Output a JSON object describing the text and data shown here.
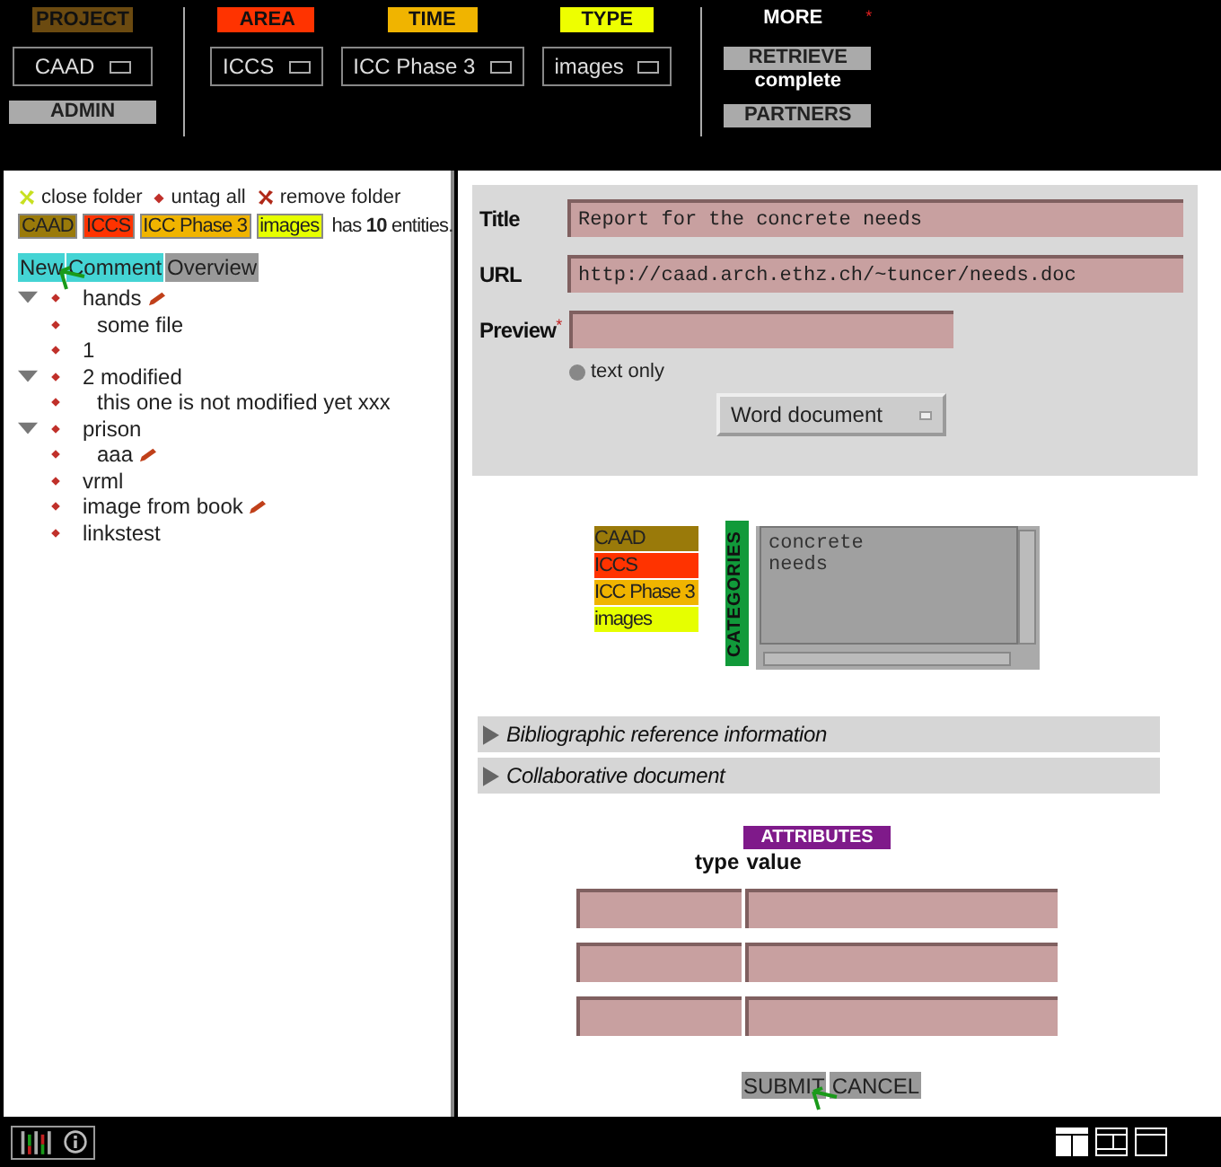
{
  "header": {
    "project": {
      "label": "PROJECT",
      "color": "#6b4a10",
      "value": "CAAD",
      "admin": "ADMIN"
    },
    "filters": [
      {
        "label": "AREA",
        "color": "#ff3300",
        "value": "ICCS"
      },
      {
        "label": "TIME",
        "color": "#f0b400",
        "value": "ICC Phase 3"
      },
      {
        "label": "TYPE",
        "color": "#eeff00",
        "value": "images"
      }
    ],
    "more": {
      "label": "MORE",
      "mark": "*",
      "retrieve": "RETRIEVE",
      "status": "complete",
      "partners": "PARTNERS"
    }
  },
  "folder_actions": [
    {
      "kind": "close",
      "label": "close folder"
    },
    {
      "kind": "untag",
      "label": "untag all"
    },
    {
      "kind": "remove",
      "label": "remove folder"
    }
  ],
  "tags": [
    {
      "label": "CAAD",
      "color": "#9a7a0a"
    },
    {
      "label": "ICCS",
      "color": "#ff3300"
    },
    {
      "label": "ICC Phase 3",
      "color": "#f0b400"
    },
    {
      "label": "images",
      "color": "#e6ff00"
    }
  ],
  "entity_count": "has **10** entities.",
  "tabs": [
    {
      "label": "New",
      "selected": true
    },
    {
      "label": "Comment",
      "selected": true
    },
    {
      "label": "Overview",
      "selected": false
    }
  ],
  "tree": [
    {
      "label": "hands",
      "editable": true,
      "expanded": true,
      "children": [
        {
          "label": "some file"
        }
      ]
    },
    {
      "label": "1"
    },
    {
      "label": "2 modified",
      "expanded": true,
      "children": [
        {
          "label": "this one is not modified yet xxx"
        }
      ]
    },
    {
      "label": "prison",
      "expanded": true,
      "children": [
        {
          "label": "aaa",
          "editable": true
        }
      ]
    },
    {
      "label": "vrml"
    },
    {
      "label": "image from book",
      "editable": true
    },
    {
      "label": "linkstest"
    }
  ],
  "form": {
    "fields": [
      {
        "label": "Title",
        "value": "Report for the concrete needs",
        "kind": "wide"
      },
      {
        "label": "URL",
        "value": "http://caad.arch.ethz.ch/~tuncer/needs.doc",
        "kind": "wide"
      },
      {
        "label": "Preview",
        "mark": "*",
        "kind": "short"
      }
    ],
    "radio": {
      "label": "text only",
      "checked": false
    },
    "doc_type": "Word document"
  },
  "categories": {
    "label": "CATEGORIES",
    "tags": [
      {
        "label": "CAAD",
        "color": "#9a7a0a"
      },
      {
        "label": "ICCS",
        "color": "#ff3300"
      },
      {
        "label": "ICC Phase 3",
        "color": "#f0b400"
      },
      {
        "label": "images",
        "color": "#e6ff00"
      }
    ],
    "text": "concrete\nneeds"
  },
  "sections": [
    {
      "label": "Bibliographic reference information",
      "expanded": false
    },
    {
      "label": "Collaborative document",
      "expanded": false
    }
  ],
  "attributes": {
    "title": "ATTRIBUTES",
    "columns": [
      "type",
      "value"
    ],
    "rows": [
      {
        "kind": "blank"
      },
      {
        "kind": "blank"
      },
      {
        "kind": "blank"
      }
    ]
  },
  "buttons": [
    "SUBMIT",
    "CANCEL"
  ],
  "layouts": [
    {
      "kind": "split",
      "selected": true
    },
    {
      "kind": "framed",
      "selected": false
    },
    {
      "kind": "single",
      "selected": false
    }
  ]
}
